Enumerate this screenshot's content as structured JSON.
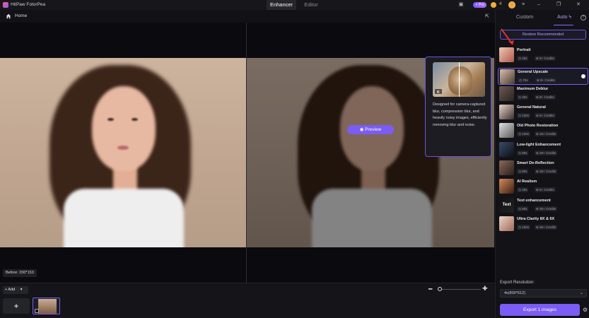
{
  "app": {
    "title": "HitPaw FotorPea"
  },
  "tabs": {
    "enhancer": "Enhancer",
    "editor": "Editor"
  },
  "titlebar": {
    "pro": "Pro",
    "credits": "4"
  },
  "nav": {
    "home": "Home"
  },
  "canvas": {
    "before_label": "Before: 200*153",
    "preview_label": "Preview"
  },
  "tooltip": {
    "text": "Designed for camera-captured blur, compression blur, and heavily noisy images, efficiently removing blur and noise."
  },
  "bottom": {
    "add_label": "+ Add",
    "add_big": "+"
  },
  "panel": {
    "tab_custom": "Custom",
    "tab_auto": "Auto",
    "restore_label": "Restore Recommended",
    "models": [
      {
        "name": "Portrait",
        "time": "40s",
        "credits": "5+ Credits"
      },
      {
        "name": "General Upscale",
        "time": "70s",
        "credits": "8+ Credits"
      },
      {
        "name": "Maximum Deblur",
        "time": "40s",
        "credits": "8+ Credits"
      },
      {
        "name": "General Natural",
        "time": "100s",
        "credits": "8+ Credits"
      },
      {
        "name": "Old Photo Restoration",
        "time": "100s",
        "credits": "16+ Credits"
      },
      {
        "name": "Low-light Enhancement",
        "time": "80s",
        "credits": "28+ Credits"
      },
      {
        "name": "Smart De-Reflection",
        "time": "80s",
        "credits": "28+ Credits"
      },
      {
        "name": "AI Realism",
        "time": "40s",
        "credits": "5+ Credits"
      },
      {
        "name": "Text enhancement",
        "time": "80s",
        "credits": "30+ Credits"
      },
      {
        "name": "Ultra Clarity 8X & 6X",
        "time": "150s",
        "credits": "36+ Credits"
      }
    ],
    "export_resolution_label": "Export Resolution:",
    "export_resolution_value": "4x(800*612)",
    "export_button": "Export 1 images"
  },
  "colors": {
    "accent": "#7b5cf5",
    "accent_light": "#b79dff",
    "background": "#0e0e12"
  }
}
